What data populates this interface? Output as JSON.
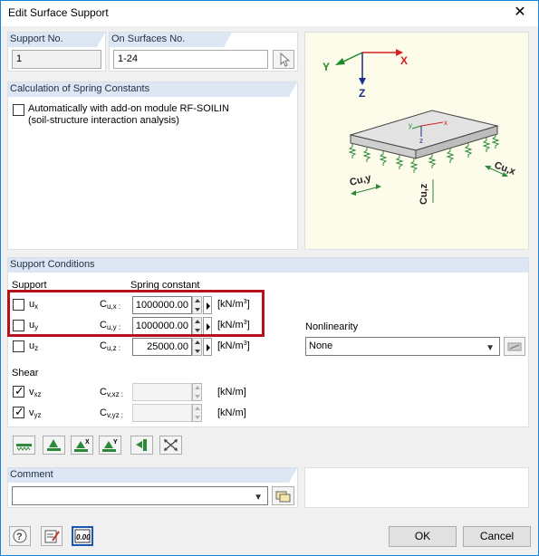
{
  "window": {
    "title": "Edit Surface Support"
  },
  "support_no": {
    "label": "Support No.",
    "value": "1"
  },
  "on_surfaces": {
    "label": "On Surfaces No.",
    "value": "1-24"
  },
  "calc": {
    "label": "Calculation of Spring Constants",
    "option_line1": "Automatically with add-on module RF-SOILIN",
    "option_line2": "(soil-structure interaction analysis)",
    "checked": false
  },
  "diagram": {
    "axis_x": "X",
    "axis_y": "Y",
    "axis_z": "Z",
    "local_x": "x",
    "local_y": "y",
    "local_z": "z",
    "label_cuy": "Cu,y",
    "label_cux": "Cu,x",
    "label_cuz": "Cu,z"
  },
  "support_conditions": {
    "label": "Support Conditions",
    "col_support": "Support",
    "col_spring": "Spring constant",
    "rows": [
      {
        "name": "u",
        "sub": "x",
        "checked": false,
        "c": "C",
        "csub": "u,x :",
        "value": "1000000.00",
        "unit": "[kN/m",
        "unit_sup": "3",
        "unit_end": "]"
      },
      {
        "name": "u",
        "sub": "y",
        "checked": false,
        "c": "C",
        "csub": "u,y :",
        "value": "1000000.00",
        "unit": "[kN/m",
        "unit_sup": "3",
        "unit_end": "]"
      },
      {
        "name": "u",
        "sub": "z",
        "checked": false,
        "c": "C",
        "csub": "u,z :",
        "value": "25000.00",
        "unit": "[kN/m",
        "unit_sup": "3",
        "unit_end": "]"
      }
    ],
    "shear_label": "Shear",
    "shear_rows": [
      {
        "name": "v",
        "sub": "xz",
        "checked": true,
        "c": "C",
        "csub": "v,xz :",
        "value": "",
        "unit": "[kN/m]"
      },
      {
        "name": "v",
        "sub": "yz",
        "checked": true,
        "c": "C",
        "csub": "v,yz :",
        "value": "",
        "unit": "[kN/m]"
      }
    ],
    "nonlinearity_label": "Nonlinearity",
    "nonlinearity_value": "None"
  },
  "toolbar": {
    "icons": [
      "support-preset-icon",
      "fixed-support-icon",
      "support-x-icon",
      "support-y-icon",
      "support-edge-icon",
      "free-support-icon"
    ]
  },
  "comment": {
    "label": "Comment",
    "value": ""
  },
  "footer": {
    "ok": "OK",
    "cancel": "Cancel",
    "num_label": "0.00"
  },
  "colors": {
    "highlight": "#b5121b",
    "axis_x": "#d82020",
    "axis_y": "#1f8a2a",
    "axis_z": "#1a2a8a",
    "header_bg": "#dde6f3"
  }
}
